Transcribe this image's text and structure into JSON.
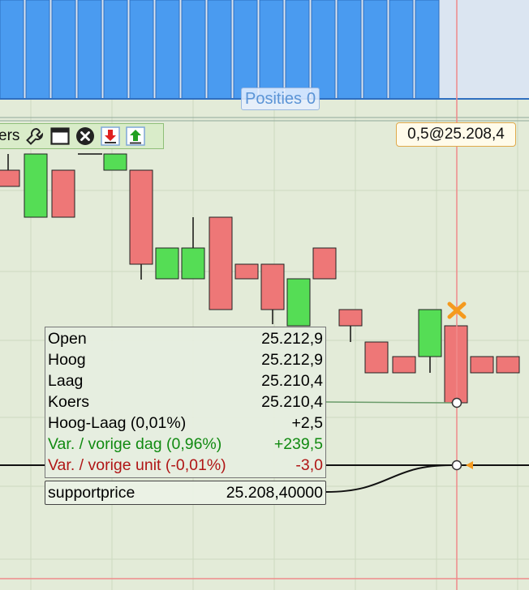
{
  "positions": {
    "label": "Posities",
    "count": "0"
  },
  "toolbar": {
    "label": "ers",
    "icons": [
      "wrench-icon",
      "window-icon",
      "close-icon",
      "download-icon",
      "upload-icon"
    ]
  },
  "order_tag": "0,5@25.208,4",
  "info": {
    "rows": [
      {
        "label": "Open",
        "value": "25.212,9"
      },
      {
        "label": "Hoog",
        "value": "25.212,9"
      },
      {
        "label": "Laag",
        "value": "25.210,4"
      },
      {
        "label": "Koers",
        "value": "25.210,4"
      },
      {
        "label": "Hoog-Laag (0,01%)",
        "value": "+2,5"
      },
      {
        "label": "Var. / vorige dag (0,96%)",
        "value": "+239,5"
      },
      {
        "label": "Var. / vorige unit (-0,01%)",
        "value": "-3,0"
      }
    ]
  },
  "support": {
    "label": "supportprice",
    "value": "25.208,40000"
  },
  "colors": {
    "background": "#e3ebd8",
    "grid": "#cdd9c0",
    "bull": "#55dd55",
    "bear": "#ee7777",
    "volume": "#4a9bf0",
    "cursor": "#f08a8a",
    "marker": "#f59a1e",
    "positive": "#118a11",
    "negative": "#b01616"
  }
}
